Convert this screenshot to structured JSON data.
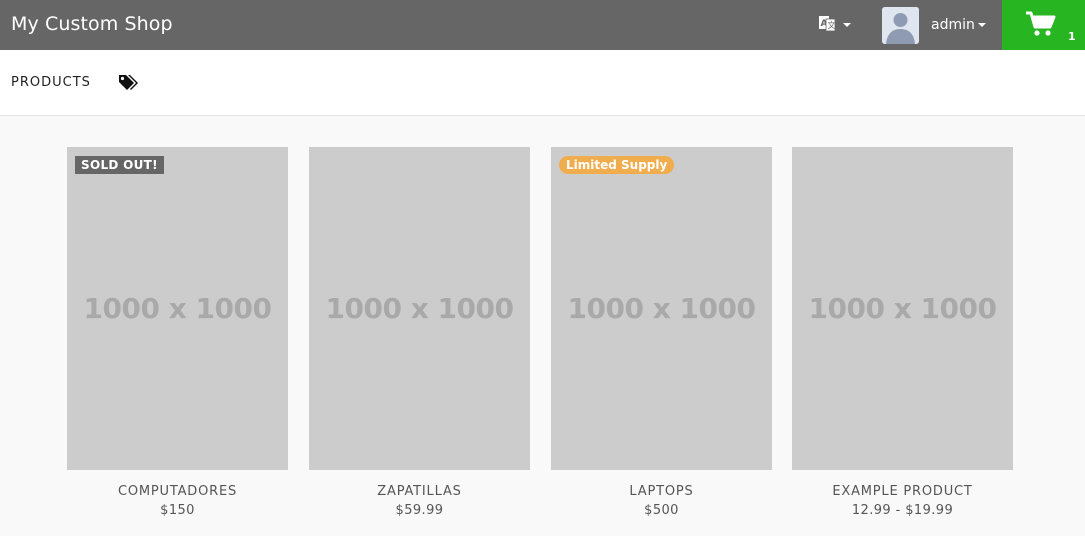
{
  "header": {
    "brand": "My Custom Shop",
    "language_icon": "translate-icon",
    "user": {
      "name": "admin",
      "avatar_icon": "user-silhouette-icon"
    },
    "cart": {
      "icon": "shopping-cart-icon",
      "count": "1"
    },
    "colors": {
      "bar": "#666666",
      "cart": "#27b522"
    }
  },
  "subnav": {
    "products_label": "PRODUCTS",
    "tags_icon": "tags-icon"
  },
  "products": [
    {
      "placeholder": "1000 x 1000",
      "badge": "SOLD OUT!",
      "name": "COMPUTADORES",
      "price": "$150"
    },
    {
      "placeholder": "1000 x 1000",
      "badge": "",
      "name": "ZAPATILLAS",
      "price": "$59.99"
    },
    {
      "placeholder": "1000 x 1000",
      "badge": "Limited Supply",
      "name": "LAPTOPS",
      "price": "$500"
    },
    {
      "placeholder": "1000 x 1000",
      "badge": "",
      "name": "EXAMPLE PRODUCT",
      "price": "12.99 - $19.99"
    }
  ],
  "badge_colors": {
    "sold_out": "#666666",
    "limited": "#f0ad4e"
  }
}
